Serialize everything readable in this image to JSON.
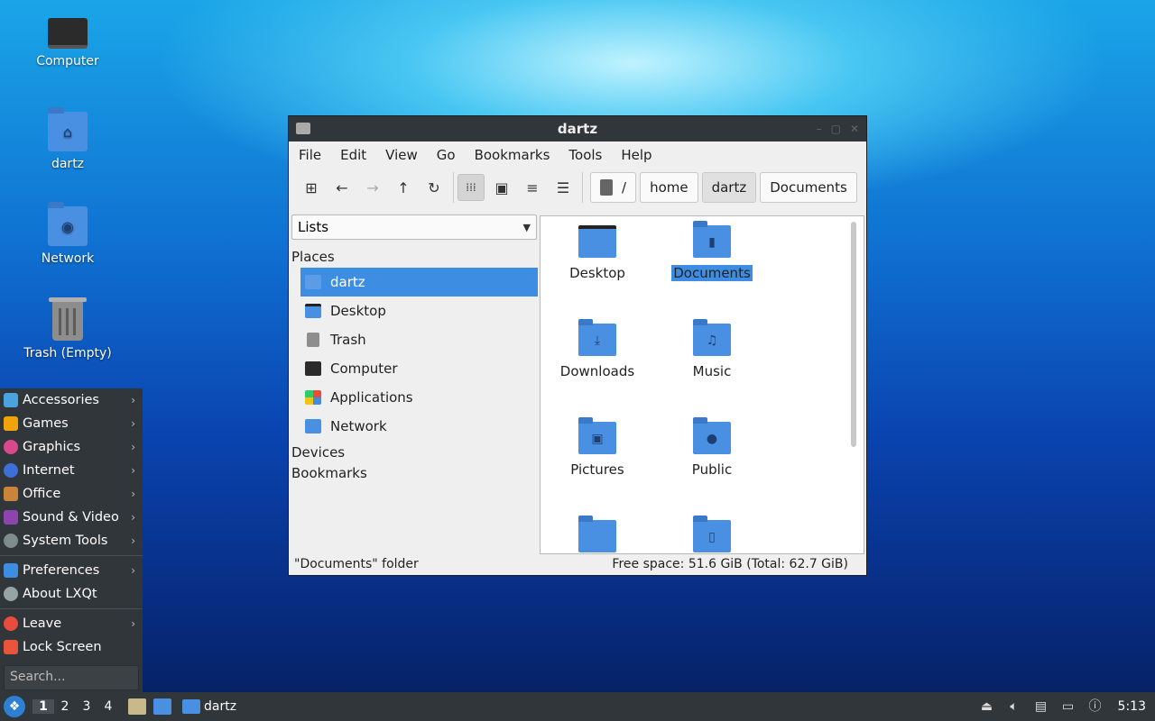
{
  "desktop": {
    "icons": [
      {
        "label": "Computer",
        "icon": "computer-icon"
      },
      {
        "label": "dartz",
        "icon": "home-folder-icon"
      },
      {
        "label": "Network",
        "icon": "network-folder-icon"
      },
      {
        "label": "Trash (Empty)",
        "icon": "trash-icon"
      }
    ]
  },
  "app_menu": {
    "items": [
      {
        "label": "Accessories",
        "color": "#4aa3df"
      },
      {
        "label": "Games",
        "color": "#f0a30a"
      },
      {
        "label": "Graphics",
        "color": "#d94a8c"
      },
      {
        "label": "Internet",
        "color": "#3d6fd8"
      },
      {
        "label": "Office",
        "color": "#c9843a"
      },
      {
        "label": "Sound & Video",
        "color": "#8e44ad"
      },
      {
        "label": "System Tools",
        "color": "#7f8c8d"
      }
    ],
    "items2": [
      {
        "label": "Preferences",
        "color": "#3d8ee2"
      },
      {
        "label": "About LXQt",
        "color": "#95a5a6"
      }
    ],
    "items3": [
      {
        "label": "Leave",
        "color": "#e74c3c"
      },
      {
        "label": "Lock Screen",
        "color": "#e8553a"
      }
    ],
    "search_placeholder": "Search..."
  },
  "taskbar": {
    "desktops": [
      "1",
      "2",
      "3",
      "4"
    ],
    "task_label": "dartz",
    "clock": "5:13"
  },
  "window": {
    "title": "dartz",
    "menu": [
      "File",
      "Edit",
      "View",
      "Go",
      "Bookmarks",
      "Tools",
      "Help"
    ],
    "breadcrumb": [
      "/",
      "home",
      "dartz",
      "Documents"
    ],
    "side_mode": "Lists",
    "sections": {
      "places": "Places",
      "devices": "Devices",
      "bookmarks": "Bookmarks"
    },
    "places": [
      {
        "label": "dartz",
        "icon": "home-icon"
      },
      {
        "label": "Desktop",
        "icon": "desktop-icon"
      },
      {
        "label": "Trash",
        "icon": "trash-icon"
      },
      {
        "label": "Computer",
        "icon": "computer-icon"
      },
      {
        "label": "Applications",
        "icon": "applications-icon"
      },
      {
        "label": "Network",
        "icon": "network-icon"
      }
    ],
    "files": [
      {
        "label": "Desktop",
        "icon": "desktop-folder-icon"
      },
      {
        "label": "Documents",
        "icon": "documents-folder-icon",
        "selected": true
      },
      {
        "label": "Downloads",
        "icon": "downloads-folder-icon"
      },
      {
        "label": "Music",
        "icon": "music-folder-icon"
      },
      {
        "label": "Pictures",
        "icon": "pictures-folder-icon"
      },
      {
        "label": "Public",
        "icon": "public-folder-icon"
      },
      {
        "label": "",
        "icon": "folder-icon"
      },
      {
        "label": "",
        "icon": "templates-folder-icon"
      }
    ],
    "status_left": "\"Documents\" folder",
    "status_right": "Free space: 51.6 GiB (Total: 62.7 GiB)"
  }
}
